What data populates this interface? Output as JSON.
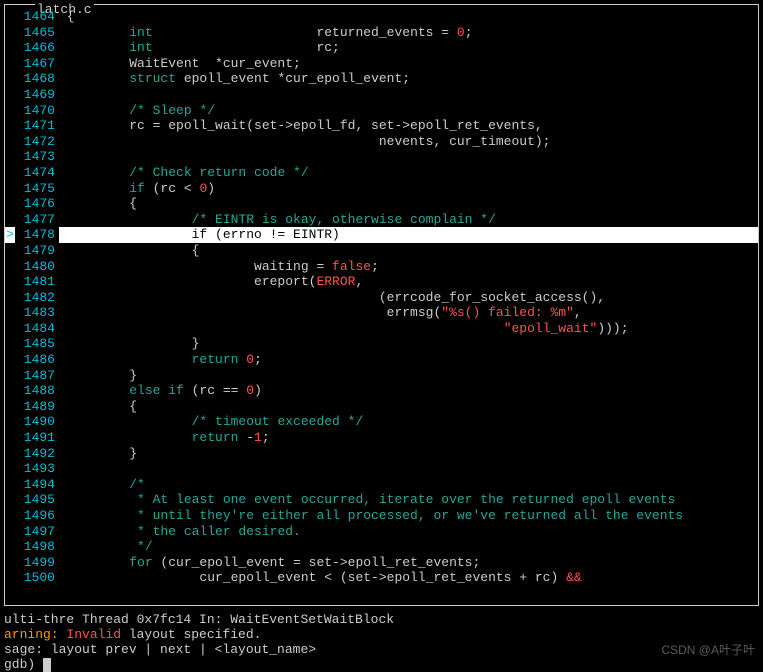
{
  "filename": "latch.c",
  "watermark": "CSDN @A叶子叶",
  "lines": [
    {
      "n": 1464,
      "pending": "",
      "tokens": [
        {
          "t": " {",
          "c": "code"
        }
      ]
    },
    {
      "n": 1465,
      "pending": "",
      "tokens": [
        {
          "t": "         ",
          "c": "code"
        },
        {
          "t": "int",
          "c": "kw"
        },
        {
          "t": "                     returned_events = ",
          "c": "code"
        },
        {
          "t": "0",
          "c": "num"
        },
        {
          "t": ";",
          "c": "code"
        }
      ]
    },
    {
      "n": 1466,
      "pending": "",
      "tokens": [
        {
          "t": "         ",
          "c": "code"
        },
        {
          "t": "int",
          "c": "kw"
        },
        {
          "t": "                     rc;",
          "c": "code"
        }
      ]
    },
    {
      "n": 1467,
      "pending": "",
      "tokens": [
        {
          "t": "         WaitEvent  *cur_event;",
          "c": "code"
        }
      ]
    },
    {
      "n": 1468,
      "pending": "",
      "tokens": [
        {
          "t": "         ",
          "c": "code"
        },
        {
          "t": "struct",
          "c": "kw"
        },
        {
          "t": " epoll_event *cur_epoll_event;",
          "c": "code"
        }
      ]
    },
    {
      "n": 1469,
      "pending": "",
      "tokens": [
        {
          "t": "",
          "c": "code"
        }
      ]
    },
    {
      "n": 1470,
      "pending": "",
      "tokens": [
        {
          "t": "         ",
          "c": "code"
        },
        {
          "t": "/* Sleep */",
          "c": "kw"
        }
      ]
    },
    {
      "n": 1471,
      "pending": "",
      "tokens": [
        {
          "t": "         rc = epoll_wait(set->epoll_fd, set->epoll_ret_events,",
          "c": "code"
        }
      ]
    },
    {
      "n": 1472,
      "pending": "",
      "tokens": [
        {
          "t": "                                         nevents, cur_timeout);",
          "c": "code"
        }
      ]
    },
    {
      "n": 1473,
      "pending": "",
      "tokens": [
        {
          "t": "",
          "c": "code"
        }
      ]
    },
    {
      "n": 1474,
      "pending": "",
      "tokens": [
        {
          "t": "         ",
          "c": "code"
        },
        {
          "t": "/* Check return code */",
          "c": "kw"
        }
      ]
    },
    {
      "n": 1475,
      "pending": "",
      "tokens": [
        {
          "t": "         ",
          "c": "code"
        },
        {
          "t": "if",
          "c": "kw"
        },
        {
          "t": " (rc < ",
          "c": "code"
        },
        {
          "t": "0",
          "c": "num"
        },
        {
          "t": ")",
          "c": "code"
        }
      ]
    },
    {
      "n": 1476,
      "pending": "",
      "tokens": [
        {
          "t": "         {",
          "c": "code"
        }
      ]
    },
    {
      "n": 1477,
      "pending": "",
      "tokens": [
        {
          "t": "                 ",
          "c": "code"
        },
        {
          "t": "/* EINTR is okay, otherwise complain */",
          "c": "kw"
        }
      ]
    },
    {
      "n": 1478,
      "pending": ">",
      "current": true,
      "tokens": [
        {
          "t": "                 if (errno != EINTR)",
          "c": "code"
        }
      ]
    },
    {
      "n": 1479,
      "pending": "",
      "tokens": [
        {
          "t": "                 {",
          "c": "code"
        }
      ]
    },
    {
      "n": 1480,
      "pending": "",
      "tokens": [
        {
          "t": "                         waiting = ",
          "c": "code"
        },
        {
          "t": "false",
          "c": "false"
        },
        {
          "t": ";",
          "c": "code"
        }
      ]
    },
    {
      "n": 1481,
      "pending": "",
      "tokens": [
        {
          "t": "                         ereport(",
          "c": "code"
        },
        {
          "t": "ERROR",
          "c": "err"
        },
        {
          "t": ",",
          "c": "code"
        }
      ]
    },
    {
      "n": 1482,
      "pending": "",
      "tokens": [
        {
          "t": "                                         (errcode_for_socket_access(),",
          "c": "code"
        }
      ]
    },
    {
      "n": 1483,
      "pending": "",
      "tokens": [
        {
          "t": "                                          errmsg(",
          "c": "code"
        },
        {
          "t": "\"%s()",
          "c": "str"
        },
        {
          "t": " failed",
          "c": "err"
        },
        {
          "t": ": %m\"",
          "c": "str"
        },
        {
          "t": ",",
          "c": "code"
        }
      ]
    },
    {
      "n": 1484,
      "pending": "",
      "tokens": [
        {
          "t": "                                                         ",
          "c": "code"
        },
        {
          "t": "\"epoll_wait\"",
          "c": "str"
        },
        {
          "t": ")));",
          "c": "code"
        }
      ]
    },
    {
      "n": 1485,
      "pending": "",
      "tokens": [
        {
          "t": "                 }",
          "c": "code"
        }
      ]
    },
    {
      "n": 1486,
      "pending": "",
      "tokens": [
        {
          "t": "                 ",
          "c": "code"
        },
        {
          "t": "return",
          "c": "kw"
        },
        {
          "t": " ",
          "c": "code"
        },
        {
          "t": "0",
          "c": "num"
        },
        {
          "t": ";",
          "c": "code"
        }
      ]
    },
    {
      "n": 1487,
      "pending": "",
      "tokens": [
        {
          "t": "         }",
          "c": "code"
        }
      ]
    },
    {
      "n": 1488,
      "pending": "",
      "tokens": [
        {
          "t": "         ",
          "c": "code"
        },
        {
          "t": "else if",
          "c": "kw"
        },
        {
          "t": " (rc == ",
          "c": "code"
        },
        {
          "t": "0",
          "c": "num"
        },
        {
          "t": ")",
          "c": "code"
        }
      ]
    },
    {
      "n": 1489,
      "pending": "",
      "tokens": [
        {
          "t": "         {",
          "c": "code"
        }
      ]
    },
    {
      "n": 1490,
      "pending": "",
      "tokens": [
        {
          "t": "                 ",
          "c": "code"
        },
        {
          "t": "/* timeout exceeded */",
          "c": "kw"
        }
      ]
    },
    {
      "n": 1491,
      "pending": "",
      "tokens": [
        {
          "t": "                 ",
          "c": "code"
        },
        {
          "t": "return",
          "c": "kw"
        },
        {
          "t": " -",
          "c": "code"
        },
        {
          "t": "1",
          "c": "num"
        },
        {
          "t": ";",
          "c": "code"
        }
      ]
    },
    {
      "n": 1492,
      "pending": "",
      "tokens": [
        {
          "t": "         }",
          "c": "code"
        }
      ]
    },
    {
      "n": 1493,
      "pending": "",
      "tokens": [
        {
          "t": "",
          "c": "code"
        }
      ]
    },
    {
      "n": 1494,
      "pending": "",
      "tokens": [
        {
          "t": "         ",
          "c": "code"
        },
        {
          "t": "/*",
          "c": "kw"
        }
      ]
    },
    {
      "n": 1495,
      "pending": "",
      "tokens": [
        {
          "t": "          ",
          "c": "code"
        },
        {
          "t": "* At least one event occurred, iterate over the returned epoll events",
          "c": "kw"
        }
      ]
    },
    {
      "n": 1496,
      "pending": "",
      "tokens": [
        {
          "t": "          ",
          "c": "code"
        },
        {
          "t": "* until they're either all processed, or we've returned all the events",
          "c": "kw"
        }
      ]
    },
    {
      "n": 1497,
      "pending": "",
      "tokens": [
        {
          "t": "          ",
          "c": "code"
        },
        {
          "t": "* the caller desired.",
          "c": "kw"
        }
      ]
    },
    {
      "n": 1498,
      "pending": "",
      "tokens": [
        {
          "t": "          ",
          "c": "code"
        },
        {
          "t": "*/",
          "c": "kw"
        }
      ]
    },
    {
      "n": 1499,
      "pending": "",
      "tokens": [
        {
          "t": "         ",
          "c": "code"
        },
        {
          "t": "for",
          "c": "kw"
        },
        {
          "t": " (cur_epoll_event = set->epoll_ret_events;",
          "c": "code"
        }
      ]
    },
    {
      "n": 1500,
      "pending": "",
      "tokens": [
        {
          "t": "                  cur_epoll_event < (set->epoll_ret_events + rc) ",
          "c": "code"
        },
        {
          "t": "&&",
          "c": "amp"
        }
      ]
    }
  ],
  "status": {
    "thread_line": "ulti-thre Thread 0x7fc14 In: WaitEventSetWaitBlock",
    "warn_label": "arning:",
    "warn_err": " Invalid",
    "warn_rest": " layout specified.",
    "usage": "sage: layout prev | next | <layout_name>",
    "gdb_prompt": "gdb) "
  }
}
